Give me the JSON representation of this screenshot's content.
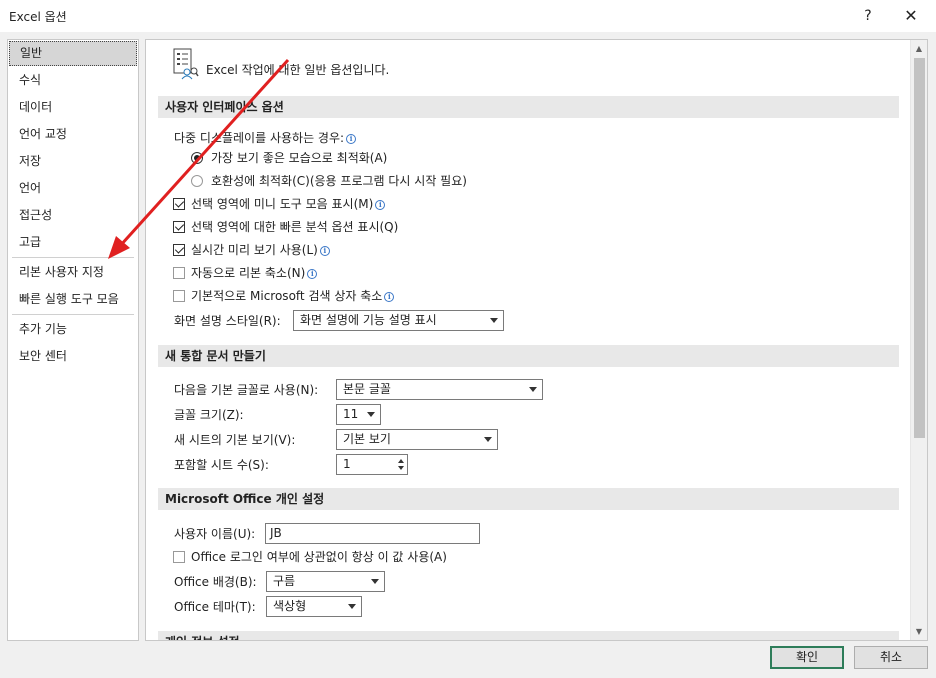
{
  "window": {
    "title": "Excel 옵션",
    "help_glyph": "?",
    "close_glyph": "✕"
  },
  "nav": {
    "items": [
      {
        "label": "일반",
        "selected": true
      },
      {
        "label": "수식"
      },
      {
        "label": "데이터"
      },
      {
        "label": "언어 교정"
      },
      {
        "label": "저장"
      },
      {
        "label": "언어"
      },
      {
        "label": "접근성"
      },
      {
        "label": "고급"
      },
      {
        "label": "리본 사용자 지정"
      },
      {
        "label": "빠른 실행 도구 모음"
      },
      {
        "label": "추가 기능"
      },
      {
        "label": "보안 센터"
      }
    ]
  },
  "intro": {
    "text": "Excel 작업에 대한 일반 옵션입니다."
  },
  "ui_options": {
    "header": "사용자 인터페이스 옵션",
    "multi_display_label": "다중 디스플레이를 사용하는 경우:",
    "radio_best": "가장 보기 좋은 모습으로 최적화(A)",
    "radio_compat": "호환성에 최적화(C)(응용 프로그램 다시 시작 필요)",
    "cb_mini_toolbar": "선택 영역에 미니 도구 모음 표시(M)",
    "cb_quick_analysis": "선택 영역에 대한 빠른 분석 옵션 표시(Q)",
    "cb_live_preview": "실시간 미리 보기 사용(L)",
    "cb_collapse_ribbon": "자동으로 리본 축소(N)",
    "cb_search_box": "기본적으로 Microsoft 검색 상자 축소",
    "screentip_label": "화면 설명 스타일(R):",
    "screentip_value": "화면 설명에 기능 설명 표시"
  },
  "workbook": {
    "header": "새 통합 문서 만들기",
    "font_label": "다음을 기본 글꼴로 사용(N):",
    "font_value": "본문 글꼴",
    "size_label": "글꼴 크기(Z):",
    "size_value": "11",
    "view_label": "새 시트의 기본 보기(V):",
    "view_value": "기본 보기",
    "sheets_label": "포함할 시트 수(S):",
    "sheets_value": "1"
  },
  "personalize": {
    "header": "Microsoft Office 개인 설정",
    "username_label": "사용자 이름(U):",
    "username_value": "JB",
    "always_use_label": "Office 로그인 여부에 상관없이 항상 이 값 사용(A)",
    "background_label": "Office 배경(B):",
    "background_value": "구름",
    "theme_label": "Office 테마(T):",
    "theme_value": "색상형"
  },
  "privacy": {
    "header": "개인 정보 설정"
  },
  "buttons": {
    "ok": "확인",
    "cancel": "취소"
  },
  "colors": {
    "annotation_arrow": "#e02020",
    "ok_border": "#2e7d5a",
    "info_icon": "#3b77c7"
  }
}
